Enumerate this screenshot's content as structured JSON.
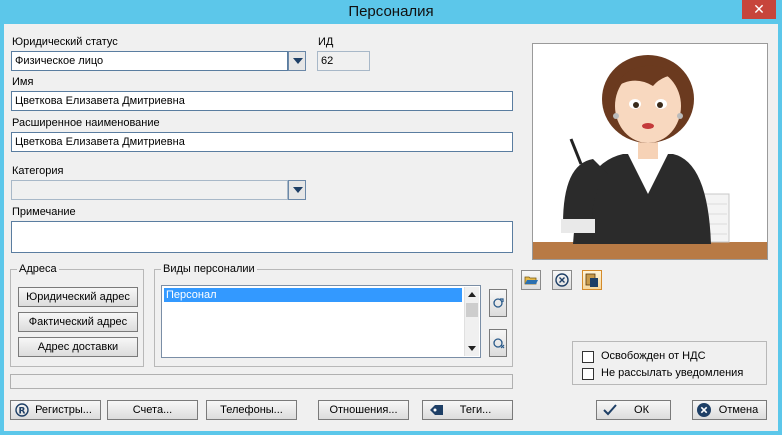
{
  "window": {
    "title": "Персоналия",
    "close_glyph": "✕"
  },
  "form": {
    "legal_status_label": "Юридический статус",
    "legal_status_value": "Физическое лицо",
    "id_label": "ИД",
    "id_value": "62",
    "name_label": "Имя",
    "name_value": "Цветкова Елизавета Дмитриевна",
    "full_name_label": "Расширенное наименование",
    "full_name_value": "Цветкова Елизавета Дмитриевна",
    "category_label": "Категория",
    "category_value": "",
    "note_label": "Примечание",
    "note_value": ""
  },
  "addresses": {
    "title": "Адреса",
    "buttons": [
      "Юридический адрес",
      "Фактический адрес",
      "Адрес доставки"
    ]
  },
  "personality_types": {
    "title": "Виды персоналии",
    "items": [
      "Персонал"
    ]
  },
  "flags": {
    "vat_exempt_label": "Освобожден от НДС",
    "vat_exempt_checked": false,
    "no_notifications_label": "Не рассылать уведомления",
    "no_notifications_checked": false
  },
  "toolbar": {
    "registers": "Регистры...",
    "accounts": "Счета...",
    "phones": "Телефоны...",
    "relations": "Отношения...",
    "tags": "Теги...",
    "ok": "ОК",
    "cancel": "Отмена"
  },
  "icons": {
    "photo_open": "folder-open-icon",
    "photo_remove": "remove-circle-icon",
    "photo_paste": "paste-icon",
    "registers": "registered-icon",
    "tags": "tag-icon",
    "ok": "checkmark-icon",
    "cancel": "cancel-circle-icon",
    "add_type": "add-type-icon",
    "remove_type": "remove-type-icon"
  },
  "colors": {
    "titlebar": "#5cc7ea",
    "close_button": "#c7453b",
    "selection": "#3399ff"
  }
}
